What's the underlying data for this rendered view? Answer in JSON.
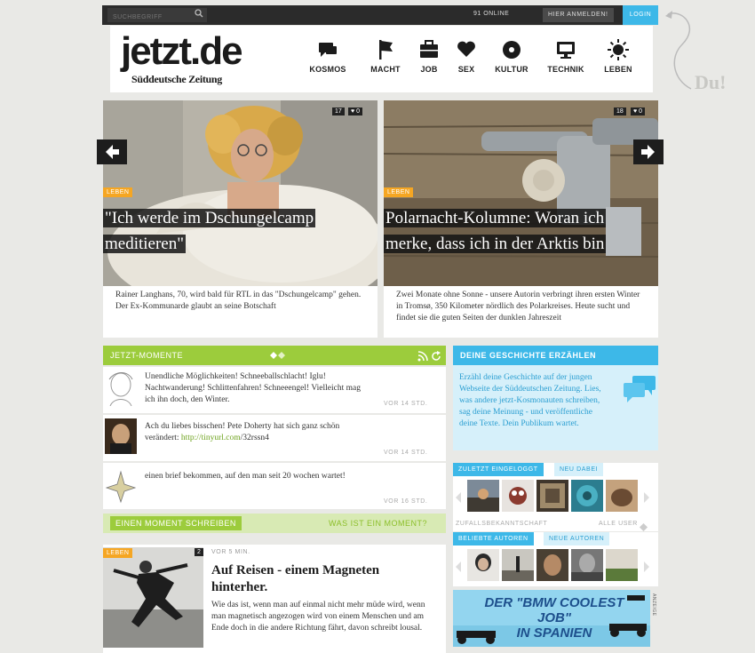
{
  "topbar": {
    "search_placeholder": "SUCHBEGRIFF",
    "online": "91 ONLINE",
    "anmelden": "HIER ANMELDEN!",
    "login": "LOGIN"
  },
  "logo": {
    "main": "jetzt.de",
    "sub": "Süddeutsche Zeitung"
  },
  "nav": [
    {
      "label": "KOSMOS",
      "icon": "chat-bubbles-icon"
    },
    {
      "label": "MACHT",
      "icon": "flag-icon"
    },
    {
      "label": "JOB",
      "icon": "briefcase-icon"
    },
    {
      "label": "SEX",
      "icon": "heart-icon"
    },
    {
      "label": "KULTUR",
      "icon": "record-icon"
    },
    {
      "label": "TECHNIK",
      "icon": "monitor-icon"
    },
    {
      "label": "LEBEN",
      "icon": "sun-icon"
    }
  ],
  "du": "Du!",
  "slides": [
    {
      "category": "LEBEN",
      "headline_1": "\"Ich werde im Dschungelcamp",
      "headline_2": "meditieren\"",
      "count_a": "17",
      "count_b": "0",
      "caption": "Rainer Langhans, 70, wird bald für RTL in das \"Dschungelcamp\" gehen. Der Ex-Kommunarde glaubt an seine Botschaft"
    },
    {
      "category": "LEBEN",
      "headline_1": "Polarnacht-Kolumne: Woran ich",
      "headline_2": "merke, dass ich in der Arktis bin",
      "count_a": "18",
      "count_b": "0",
      "caption": "Zwei Monate ohne Sonne - unsere Autorin verbringt ihren ersten Winter in Tromsø, 350 Kilometer nördlich des Polarkreises. Heute sucht und findet sie die guten Seiten der dunklen Jahreszeit"
    }
  ],
  "moments": {
    "title": "JETZT-MOMENTE",
    "items": [
      {
        "text": "Unendliche Möglichkeiten! Schneeballschlacht! Iglu! Nachtwanderung! Schlittenfahren! Schneeengel! Vielleicht mag ich ihn doch, den Winter.",
        "time": "VOR 14 STD."
      },
      {
        "text_pre": "Ach du liebes bisschen! Pete Doherty hat sich ganz schön verändert: ",
        "link": "http://tinyurl.com",
        "text_post": "/32rssn4",
        "time": "VOR 14 STD."
      },
      {
        "text": "einen brief bekommen, auf den man seit 20 wochen wartet!",
        "time": "VOR 16 STD."
      }
    ],
    "write": "EINEN MOMENT SCHREIBEN",
    "what": "WAS IST EIN MOMENT?"
  },
  "article": {
    "category": "LEBEN",
    "comments": "2",
    "time": "VOR 5 MIN.",
    "title_1": "Auf Reisen - einem Magneten",
    "title_2": "hinterher.",
    "teaser": "Wie das ist, wenn man auf einmal nicht mehr müde wird, wenn man magnetisch angezogen wird von einem Menschen und am Ende doch in die andere Richtung fährt, davon schreibt lousal."
  },
  "right": {
    "deine_title": "DEINE GESCHICHTE ERZÄHLEN",
    "deine_text": "Erzähl deine Geschichte auf der jungen Webseite der Süddeutschen Zeitung. Lies, was andere jetzt-Kosmonauten schreiben, sag deine Meinung - und veröffentliche deine Texte. Dein Publikum wartet.",
    "tab_last": "ZULETZT EINGELOGGT",
    "tab_new": "NEU DABEI",
    "random": "ZUFALLSBEKANNTSCHAFT",
    "all_users": "ALLE USER",
    "tab_popular": "BELIEBTE AUTOREN",
    "tab_new_authors": "NEUE AUTOREN",
    "ad_line1": "DER \"BMW COOLEST JOB\"",
    "ad_line2": "IN SPANIEN",
    "ad_label": "ANZEIGE"
  },
  "colors": {
    "accent_blue": "#3db8e8",
    "accent_green": "#9ccc3c",
    "accent_orange": "#f5a623"
  }
}
